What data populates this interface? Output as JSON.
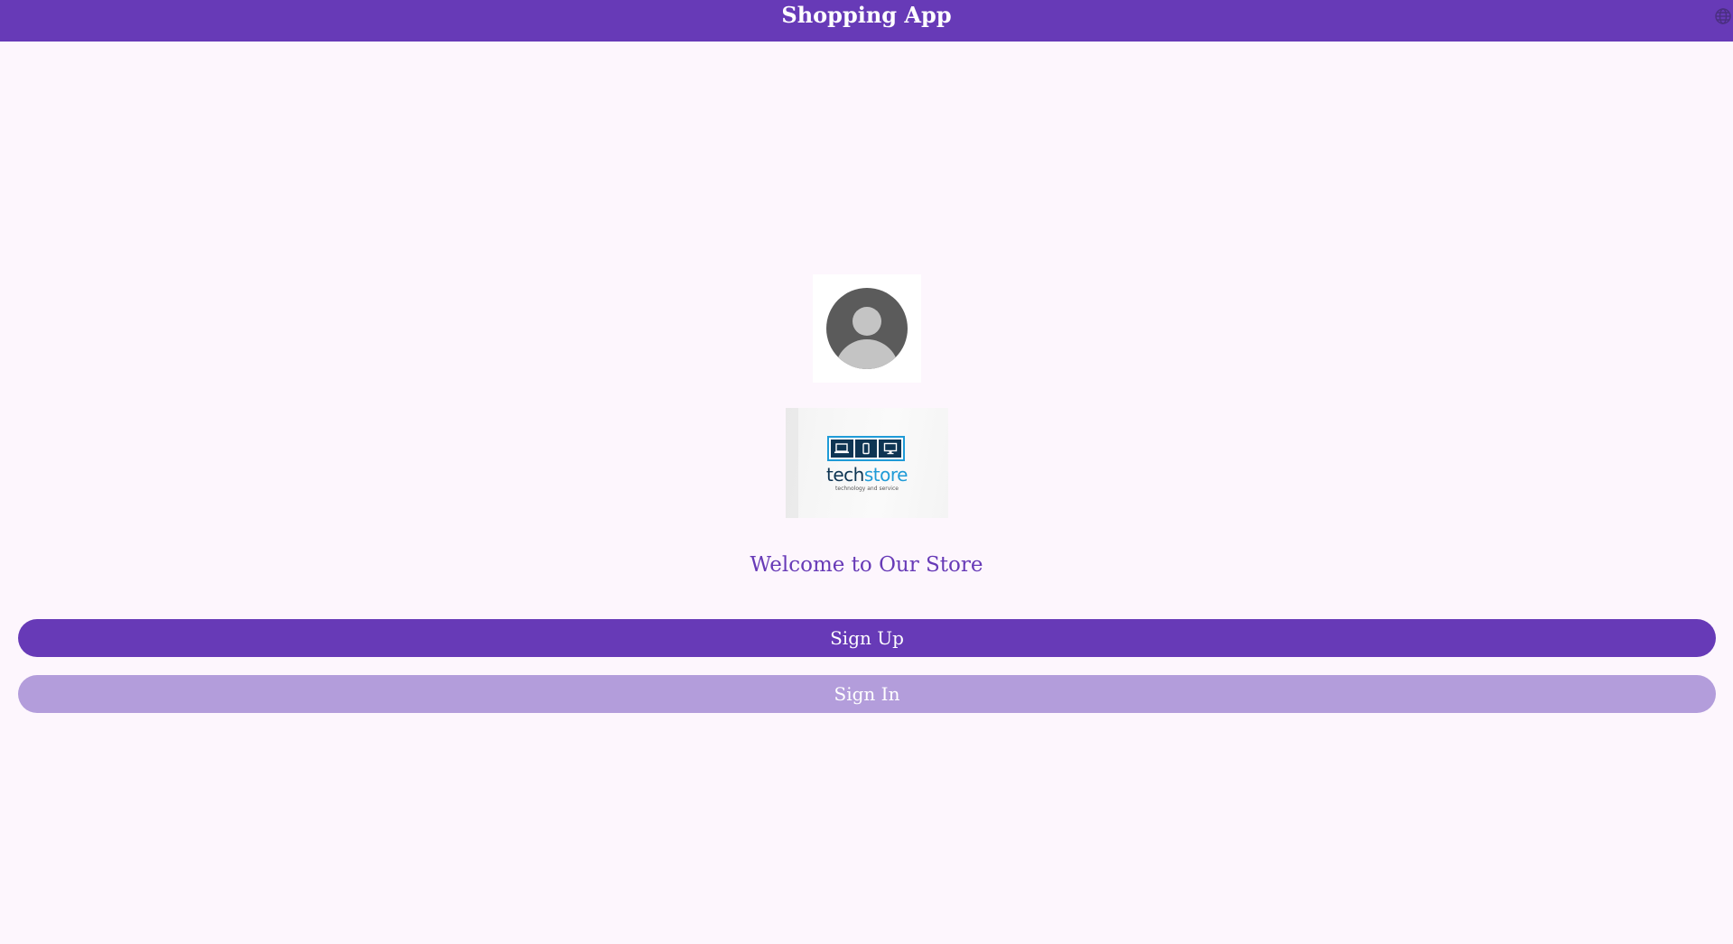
{
  "header": {
    "title": "Shopping App",
    "language_icon": "globe-icon"
  },
  "main": {
    "avatar_icon": "user-avatar-icon",
    "logo": {
      "brand_part1": "tech",
      "brand_part2": "store",
      "tagline": "technology and service"
    },
    "welcome_text": "Welcome to Our Store",
    "sign_up_label": "Sign Up",
    "sign_in_label": "Sign In"
  },
  "colors": {
    "primary": "#673ab7",
    "primary_light": "#b39ddb",
    "background": "#fdf6fd",
    "logo_dark": "#0e3553",
    "logo_blue": "#1f9bd7"
  }
}
